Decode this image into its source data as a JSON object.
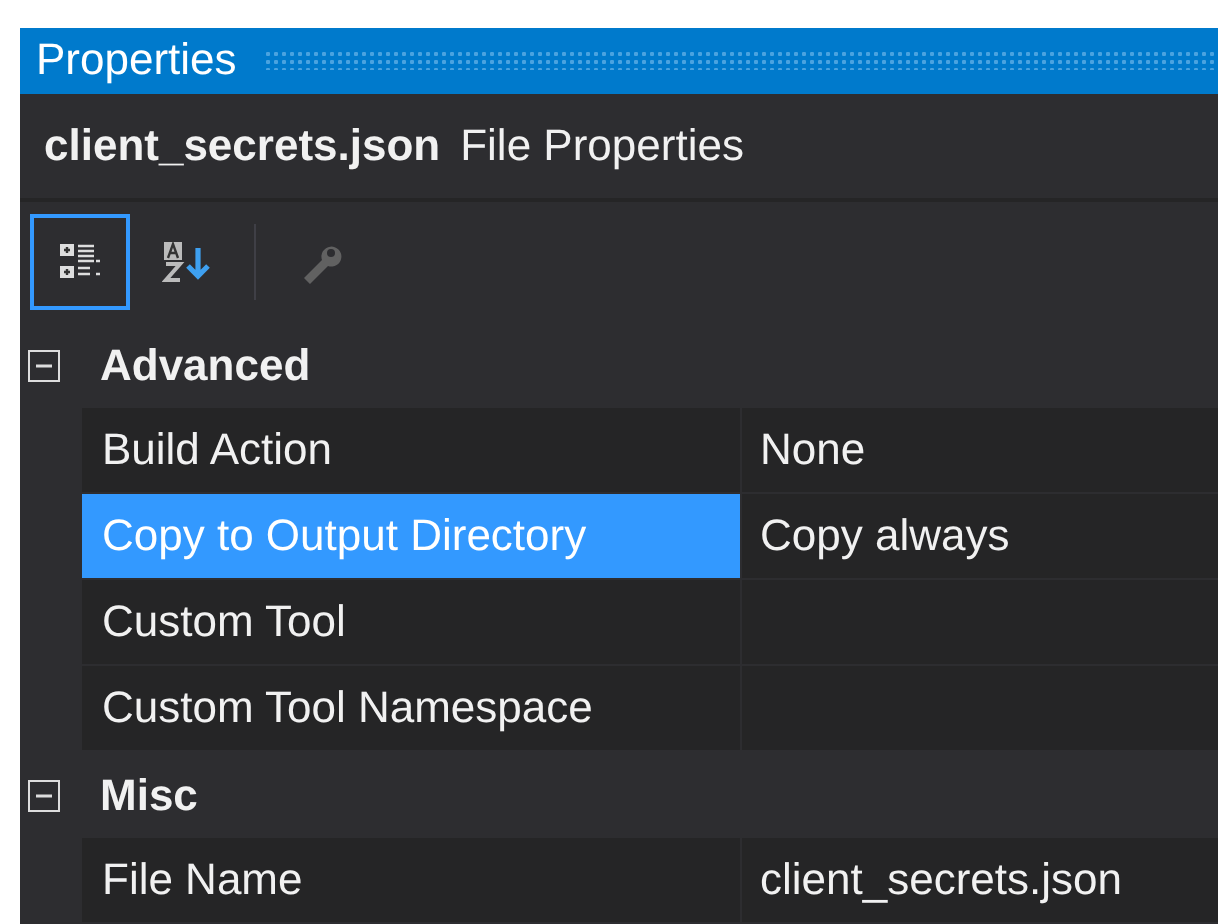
{
  "window": {
    "title": "Properties"
  },
  "header": {
    "object": "client_secrets.json",
    "type": "File Properties"
  },
  "toolbar": [
    {
      "kind": "categorized",
      "selected": true,
      "disabled": false
    },
    {
      "kind": "alphabetical",
      "selected": false,
      "disabled": false
    },
    {
      "kind": "property-pages",
      "selected": false,
      "disabled": true
    }
  ],
  "categories": [
    {
      "name": "Advanced",
      "expanded": true,
      "rows": [
        {
          "name": "Build Action",
          "value": "None",
          "selected": false
        },
        {
          "name": "Copy to Output Directory",
          "value": "Copy always",
          "selected": true
        },
        {
          "name": "Custom Tool",
          "selected": false
        },
        {
          "name": "Custom Tool Namespace",
          "selected": false
        }
      ]
    },
    {
      "name": "Misc",
      "expanded": true,
      "rows": [
        {
          "name": "File Name",
          "value": "client_secrets.json",
          "selected": false
        }
      ]
    }
  ]
}
